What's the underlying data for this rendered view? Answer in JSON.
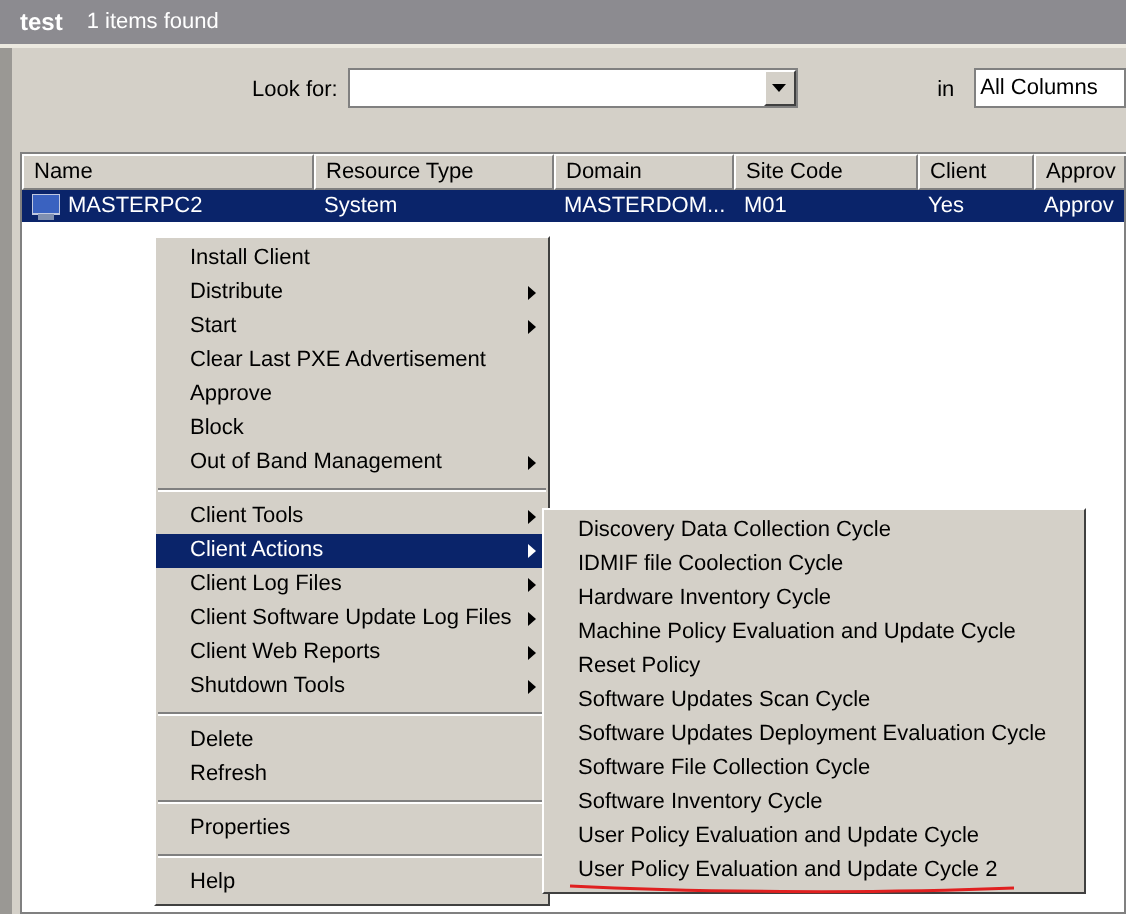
{
  "header": {
    "title": "test",
    "count": "1 items found"
  },
  "search": {
    "label": "Look for:",
    "in_label": "in",
    "scope": "All Columns"
  },
  "table": {
    "columns": [
      "Name",
      "Resource Type",
      "Domain",
      "Site Code",
      "Client",
      "Approv"
    ],
    "rows": [
      {
        "selected": true,
        "cells": [
          "MASTERPC2",
          "System",
          "MASTERDOM...",
          "M01",
          "Yes",
          "Approv"
        ]
      }
    ]
  },
  "context_menu": {
    "groups": [
      [
        {
          "label": "Install Client",
          "submenu": false,
          "selected": false
        },
        {
          "label": "Distribute",
          "submenu": true,
          "selected": false
        },
        {
          "label": "Start",
          "submenu": true,
          "selected": false
        },
        {
          "label": "Clear Last PXE Advertisement",
          "submenu": false,
          "selected": false
        },
        {
          "label": "Approve",
          "submenu": false,
          "selected": false
        },
        {
          "label": "Block",
          "submenu": false,
          "selected": false
        },
        {
          "label": "Out of Band Management",
          "submenu": true,
          "selected": false
        }
      ],
      [
        {
          "label": "Client Tools",
          "submenu": true,
          "selected": false
        },
        {
          "label": "Client Actions",
          "submenu": true,
          "selected": true
        },
        {
          "label": "Client Log Files",
          "submenu": true,
          "selected": false
        },
        {
          "label": "Client Software Update Log Files",
          "submenu": true,
          "selected": false
        },
        {
          "label": "Client Web Reports",
          "submenu": true,
          "selected": false
        },
        {
          "label": "Shutdown Tools",
          "submenu": true,
          "selected": false
        }
      ],
      [
        {
          "label": "Delete",
          "submenu": false,
          "selected": false
        },
        {
          "label": "Refresh",
          "submenu": false,
          "selected": false
        }
      ],
      [
        {
          "label": "Properties",
          "submenu": false,
          "selected": false
        }
      ],
      [
        {
          "label": "Help",
          "submenu": false,
          "selected": false
        }
      ]
    ]
  },
  "submenu": {
    "items": [
      {
        "label": "Discovery Data Collection Cycle",
        "underlined": false
      },
      {
        "label": "IDMIF file Coolection Cycle",
        "underlined": false
      },
      {
        "label": "Hardware Inventory Cycle",
        "underlined": false
      },
      {
        "label": "Machine Policy Evaluation and Update Cycle",
        "underlined": false
      },
      {
        "label": "Reset Policy",
        "underlined": false
      },
      {
        "label": "Software Updates Scan Cycle",
        "underlined": false
      },
      {
        "label": "Software Updates Deployment Evaluation Cycle",
        "underlined": false
      },
      {
        "label": "Software File Collection Cycle",
        "underlined": false
      },
      {
        "label": "Software Inventory Cycle",
        "underlined": false
      },
      {
        "label": "User Policy Evaluation and Update Cycle",
        "underlined": false
      },
      {
        "label": "User Policy Evaluation and Update Cycle 2",
        "underlined": true
      }
    ]
  }
}
